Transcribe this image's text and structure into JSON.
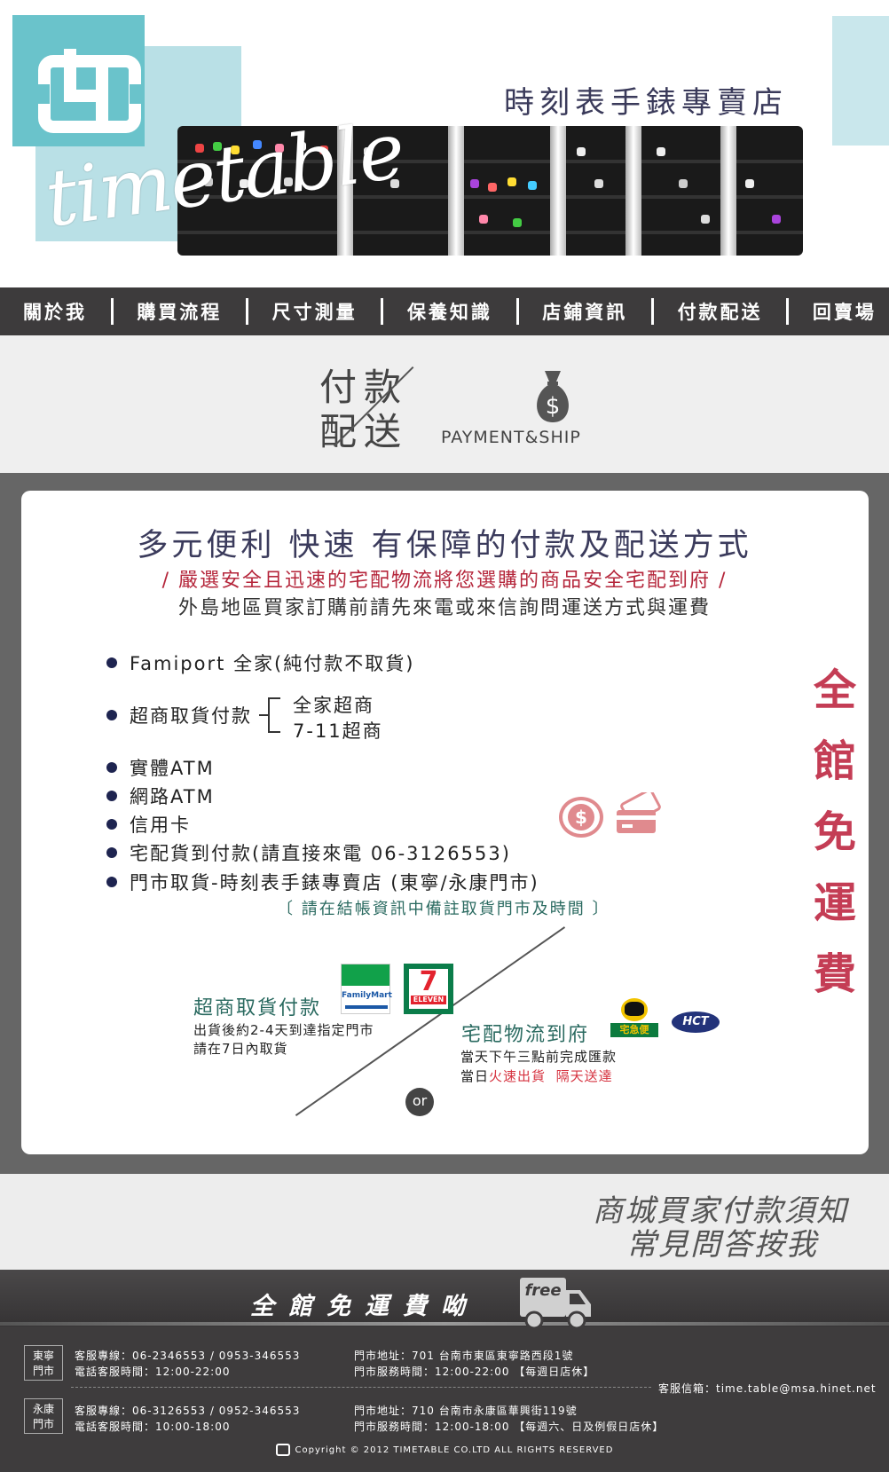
{
  "header": {
    "store_title": "時刻表手錶專賣店",
    "script_logo": "timetable"
  },
  "nav": {
    "items": [
      "關於我",
      "購買流程",
      "尺寸測量",
      "保養知識",
      "店鋪資訊",
      "付款配送",
      "回賣場"
    ]
  },
  "section": {
    "title_line1": "付款",
    "title_line2": "配送",
    "subtitle_en": "PAYMENT&SHIP"
  },
  "main": {
    "headline": "多元便利 快速 有保障的付款及配送方式",
    "sub_red": "/ 嚴選安全且迅速的宅配物流將您選購的商品安全宅配到府 /",
    "sub_dark": "外島地區買家訂購前請先來電或來信詢問運送方式與運費",
    "payments": [
      "Famiport 全家(純付款不取貨)",
      "超商取貨付款",
      "實體ATM",
      "網路ATM",
      "信用卡",
      "宅配貨到付款(請直接來電 06-3126553)",
      "門市取貨-時刻表手錶專賣店 (東寧/永康門市)"
    ],
    "cvs_options": [
      "全家超商",
      "7-11超商"
    ],
    "pickup_note": "〔 請在結帳資訊中備註取貨門市及時間 〕",
    "free_vertical": "全館免運費",
    "cvs_block": {
      "title": "超商取貨付款",
      "line1": "出貨後約2-4天到達指定門市",
      "line2": "請在7日內取貨",
      "familymart": "FamilyMart",
      "seven": "7",
      "seven_sub": "ELEVEN"
    },
    "or_label": "or",
    "home_block": {
      "title": "宅配物流到府",
      "line1": "當天下午三點前完成匯款",
      "line2_prefix": "當日",
      "line2_red1": "火速出貨",
      "line2_red2": "隔天送達",
      "tcat": "宅急便",
      "hct": "HCT"
    }
  },
  "faq": {
    "line1": "商城買家付款須知",
    "line2": "常見問答按我"
  },
  "footer": {
    "banner": "全館免運費呦",
    "truck_label": "free",
    "stores": [
      {
        "tag_line1": "東寧",
        "tag_line2": "門市",
        "phone": "客服專線：06-2346553 / 0953-346553",
        "phone_hours": "電話客服時間：12:00-22:00",
        "address": "門市地址：701 台南市東區東寧路西段1號",
        "store_hours": "門市服務時間：12:00-22:00 【每週日店休】"
      },
      {
        "tag_line1": "永康",
        "tag_line2": "門市",
        "phone": "客服專線：06-3126553 / 0952-346553",
        "phone_hours": "電話客服時間：10:00-18:00",
        "address": "門市地址：710 台南市永康區華興街119號",
        "store_hours": "門市服務時間：12:00-18:00 【每週六、日及例假日店休】"
      }
    ],
    "email": "客服信箱：time.table@msa.hinet.net",
    "copyright": "Copyright © 2012 TIMETABLE CO.LTD ALL RIGHTS RESERVED"
  },
  "colors": {
    "teal": "#6ac3cb",
    "light_teal": "#b9e0e6",
    "nav_bg": "#3d3b3c",
    "accent_red": "#c43d55",
    "deep_teal_text": "#2a6a60"
  }
}
